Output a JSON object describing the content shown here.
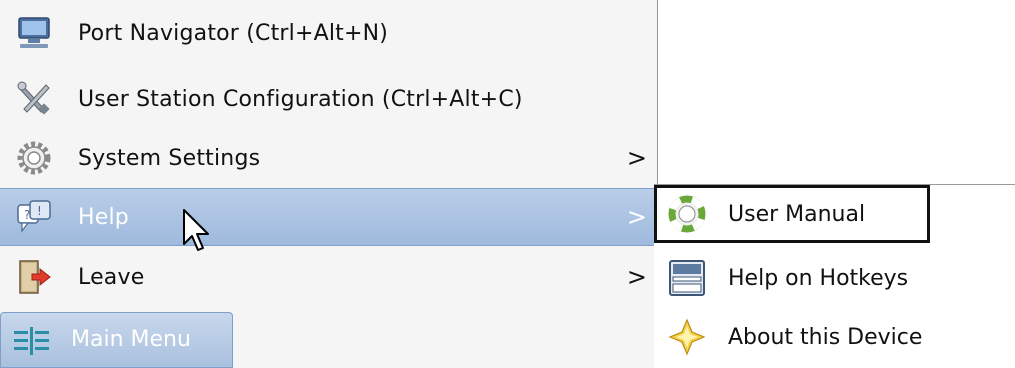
{
  "menu": {
    "items": [
      {
        "label": "Port Navigator (Ctrl+Alt+N)",
        "icon": "monitor-network-icon",
        "has_submenu": false
      },
      {
        "label": "User Station Configuration (Ctrl+Alt+C)",
        "icon": "tools-icon",
        "has_submenu": false
      },
      {
        "label": "System Settings",
        "icon": "gear-icon",
        "has_submenu": true,
        "arrow": ">"
      },
      {
        "label": "Help",
        "icon": "help-chat-icon",
        "has_submenu": true,
        "arrow": ">",
        "selected": true
      },
      {
        "label": "Leave",
        "icon": "exit-door-icon",
        "has_submenu": true,
        "arrow": ">"
      }
    ],
    "main_menu_label": "Main Menu"
  },
  "submenu": {
    "items": [
      {
        "label": "User Manual",
        "icon": "lifebuoy-icon"
      },
      {
        "label": "Help on Hotkeys",
        "icon": "keyboard-window-icon"
      },
      {
        "label": "About this Device",
        "icon": "star-diamond-icon"
      }
    ]
  },
  "colors": {
    "selection": "#a9c0de",
    "selection_border": "#7f9fc8",
    "menu_bg": "#f5f5f5"
  }
}
